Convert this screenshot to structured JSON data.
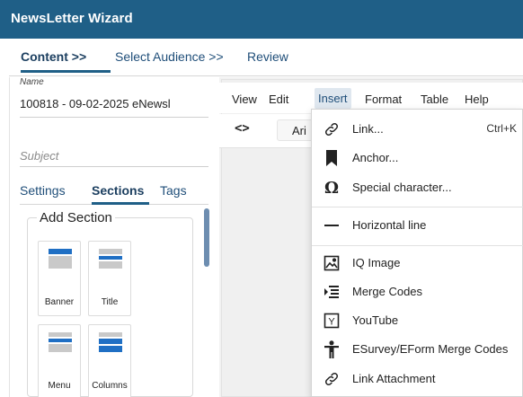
{
  "window": {
    "title": "NewsLetter Wizard"
  },
  "wizard_steps": [
    {
      "label": "Content >>"
    },
    {
      "label": "Select Audience >>"
    },
    {
      "label": "Review"
    }
  ],
  "fields": {
    "name_label": "Name",
    "name_value": "100818 - 09-02-2025 eNewsl",
    "subject_placeholder": "Subject"
  },
  "left_tabs": [
    {
      "label": "Settings"
    },
    {
      "label": "Sections"
    },
    {
      "label": "Tags"
    }
  ],
  "add_section": {
    "title": "Add Section",
    "tiles": [
      {
        "label": "Banner"
      },
      {
        "label": "Title"
      },
      {
        "label": "Menu"
      },
      {
        "label": "Columns"
      }
    ]
  },
  "editor": {
    "menus": [
      {
        "label": "View"
      },
      {
        "label": "Edit"
      },
      {
        "label": "Insert"
      },
      {
        "label": "Format"
      },
      {
        "label": "Table"
      },
      {
        "label": "Help"
      }
    ],
    "toolbar": {
      "code_symbol": "<>",
      "font_value": "Ari"
    }
  },
  "insert_menu": {
    "items": [
      {
        "label": "Link...",
        "shortcut": "Ctrl+K",
        "icon": "link-icon"
      },
      {
        "label": "Anchor...",
        "icon": "bookmark-icon"
      },
      {
        "label": "Special character...",
        "icon": "omega-icon"
      },
      {
        "label": "Horizontal line",
        "icon": "horizontal-line-icon"
      },
      {
        "label": "IQ Image",
        "icon": "image-icon"
      },
      {
        "label": "Merge Codes",
        "icon": "merge-codes-icon"
      },
      {
        "label": "YouTube",
        "icon": "youtube-icon"
      },
      {
        "label": "ESurvey/EForm Merge Codes",
        "icon": "person-icon"
      },
      {
        "label": "Link Attachment",
        "icon": "link-icon"
      }
    ]
  },
  "colors": {
    "title_bar": "#1f5f87",
    "accent": "#1f4e79",
    "scroll_thumb": "#6d8db0",
    "tile_blue": "#1f6fc4",
    "tile_gray": "#c9c9c9"
  }
}
